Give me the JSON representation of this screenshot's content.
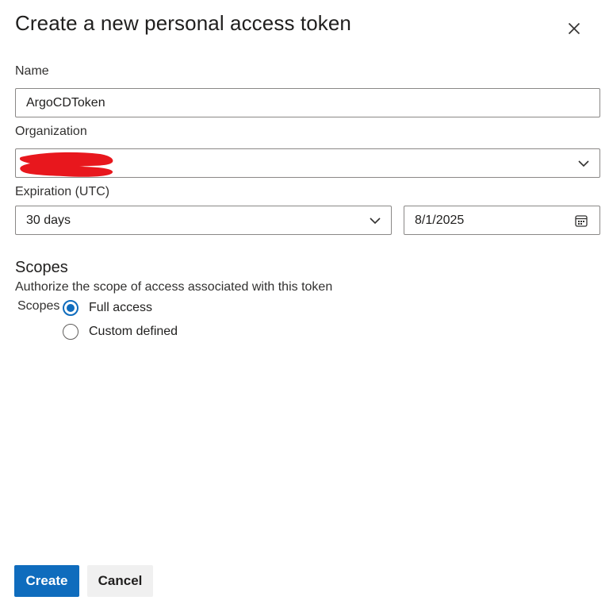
{
  "dialog": {
    "title": "Create a new personal access token",
    "close_icon": "close-icon"
  },
  "form": {
    "name": {
      "label": "Name",
      "value": "ArgoCDToken"
    },
    "organization": {
      "label": "Organization",
      "value": "",
      "redacted": true,
      "icon": "chevron-down-icon"
    },
    "expiration": {
      "label": "Expiration (UTC)",
      "duration_value": "30 days",
      "date_value": "8/1/2025",
      "duration_icon": "chevron-down-icon",
      "date_icon": "calendar-icon"
    }
  },
  "scopes": {
    "title": "Scopes",
    "description": "Authorize the scope of access associated with this token",
    "label": "Scopes",
    "options": [
      {
        "label": "Full access",
        "checked": true
      },
      {
        "label": "Custom defined",
        "checked": false
      }
    ]
  },
  "actions": {
    "create_label": "Create",
    "cancel_label": "Cancel"
  },
  "colors": {
    "accent": "#0f6cbd",
    "redaction": "#e8171d"
  }
}
